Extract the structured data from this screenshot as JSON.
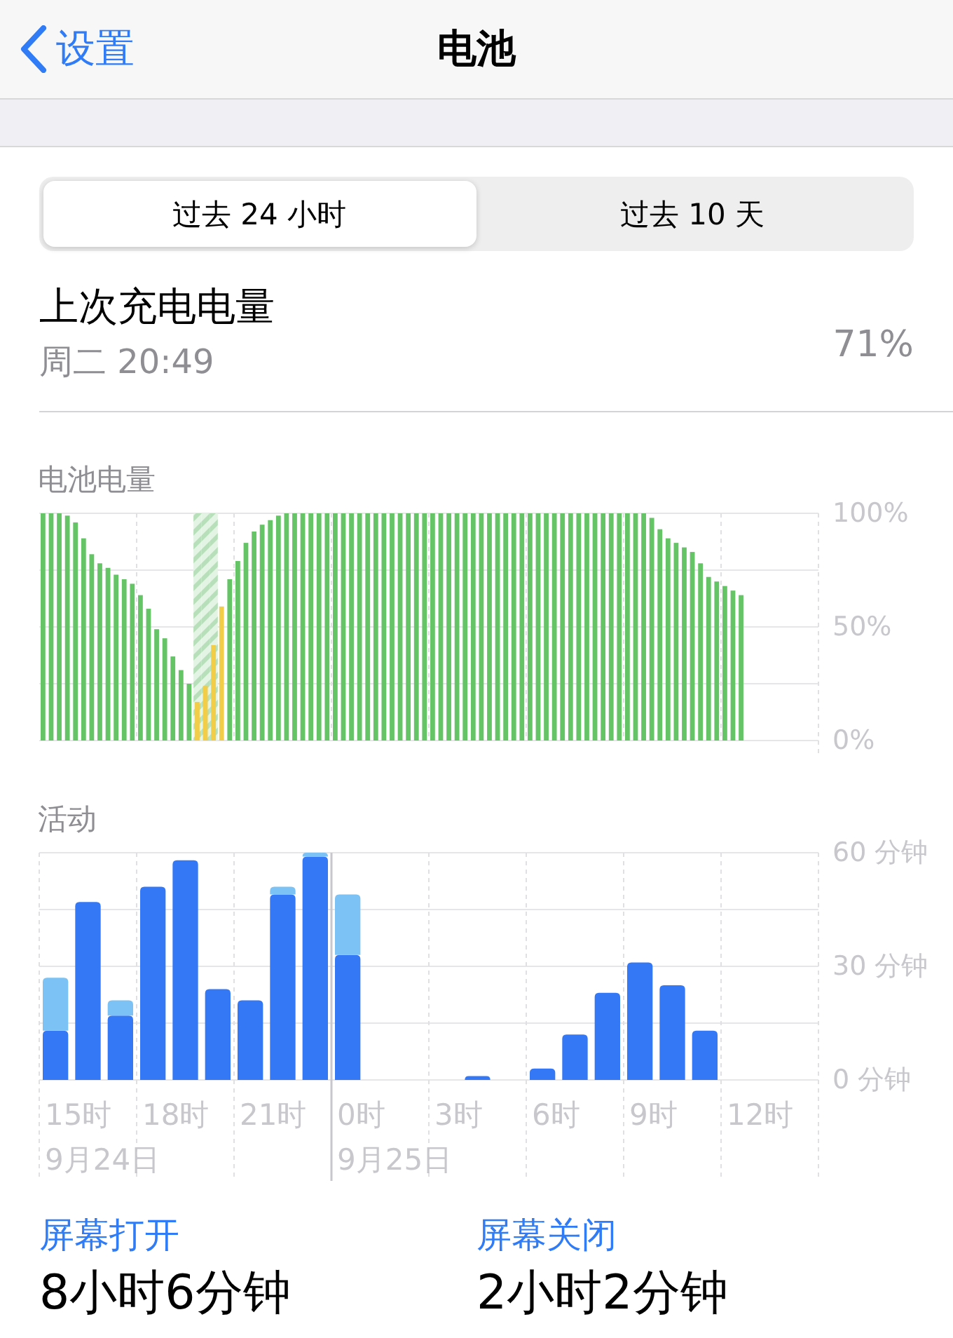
{
  "nav": {
    "back_label": "设置",
    "title": "电池"
  },
  "segments": [
    {
      "label": "过去 24 小时",
      "selected": true
    },
    {
      "label": "过去 10 天",
      "selected": false
    }
  ],
  "last_charge": {
    "label": "上次充电电量",
    "time": "周二 20:49",
    "level_text": "71%"
  },
  "battery": {
    "heading": "电池电量",
    "chart_data": {
      "type": "bar",
      "grid": true,
      "ylim": [
        0,
        100
      ],
      "yticks": [
        {
          "value": 0,
          "label": "0%"
        },
        {
          "value": 50,
          "label": "50%"
        },
        {
          "value": 100,
          "label": "100%"
        }
      ],
      "series": [
        {
          "color": "#b7dfb9",
          "values": [
            null,
            null,
            null,
            null,
            null,
            null,
            null,
            null,
            null,
            null,
            null,
            null,
            null,
            null,
            null,
            null,
            null,
            null,
            null,
            100,
            100,
            100,
            null,
            null,
            null,
            null,
            null,
            null,
            null,
            null,
            null,
            null,
            null,
            null,
            null,
            null,
            null,
            null,
            null,
            null,
            null,
            null,
            null,
            null,
            null,
            null,
            null,
            null,
            null,
            null,
            null,
            null,
            null,
            null,
            null,
            null,
            null,
            null,
            null,
            null,
            null,
            null,
            null,
            null,
            null,
            null,
            null,
            null,
            null,
            null,
            null,
            null,
            null,
            null,
            null,
            null,
            null,
            null,
            null,
            null,
            null,
            null,
            null,
            null,
            null,
            null,
            null,
            null,
            null,
            null,
            null,
            null,
            null,
            null,
            null,
            null
          ]
        },
        {
          "color": "#65c466",
          "values": [
            100,
            100,
            100,
            99,
            96,
            89,
            82,
            78,
            76,
            73,
            71,
            69,
            64,
            58,
            49,
            45,
            37,
            31,
            25,
            null,
            null,
            null,
            null,
            71,
            79,
            87,
            92,
            95,
            97,
            99,
            100,
            100,
            100,
            100,
            100,
            100,
            100,
            100,
            100,
            100,
            100,
            100,
            100,
            100,
            100,
            100,
            100,
            100,
            100,
            100,
            100,
            100,
            100,
            100,
            100,
            100,
            100,
            100,
            100,
            100,
            100,
            100,
            100,
            100,
            100,
            100,
            100,
            100,
            100,
            100,
            100,
            100,
            100,
            100,
            100,
            98,
            93,
            89,
            87,
            85,
            83,
            78,
            72,
            70,
            68,
            66,
            64,
            null,
            null,
            null,
            null,
            null,
            null,
            null,
            null,
            null
          ]
        },
        {
          "color": "#f2cd48",
          "values": [
            null,
            null,
            null,
            null,
            null,
            null,
            null,
            null,
            null,
            null,
            null,
            null,
            null,
            null,
            null,
            null,
            null,
            null,
            null,
            17,
            24,
            42,
            59,
            null,
            null,
            null,
            null,
            null,
            null,
            null,
            null,
            null,
            null,
            null,
            null,
            null,
            null,
            null,
            null,
            null,
            null,
            null,
            null,
            null,
            null,
            null,
            null,
            null,
            null,
            null,
            null,
            null,
            null,
            null,
            null,
            null,
            null,
            null,
            null,
            null,
            null,
            null,
            null,
            null,
            null,
            null,
            null,
            null,
            null,
            null,
            null,
            null,
            null,
            null,
            null,
            null,
            null,
            null,
            null,
            null,
            null,
            null,
            null,
            null,
            null,
            null,
            null,
            null,
            null,
            null,
            null,
            null,
            null,
            null,
            null,
            null
          ]
        }
      ]
    }
  },
  "activity": {
    "heading": "活动",
    "chart_data": {
      "type": "bar",
      "stacked": true,
      "grid": true,
      "ylim": [
        0,
        60
      ],
      "yticks": [
        {
          "value": 0,
          "label": "0 分钟"
        },
        {
          "value": 30,
          "label": "30 分钟"
        },
        {
          "value": 60,
          "label": "60 分钟"
        }
      ],
      "series": [
        {
          "color": "#3478f6",
          "values": [
            13,
            47,
            17,
            51,
            58,
            24,
            21,
            49,
            59,
            33,
            0,
            0,
            0,
            1,
            0,
            3,
            12,
            23,
            31,
            25,
            13,
            0,
            0,
            0
          ]
        },
        {
          "color": "#7cc2f4",
          "values": [
            14,
            0,
            4,
            0,
            0,
            0,
            0,
            2,
            1,
            16,
            0,
            0,
            0,
            0,
            0,
            0,
            0,
            0,
            0,
            0,
            0,
            0,
            0,
            0
          ]
        }
      ]
    },
    "days": [
      {
        "hours": [
          "15时",
          "18时",
          "21时"
        ],
        "date": "9月24日"
      },
      {
        "hours": [
          "0时",
          "3时",
          "6时",
          "9时",
          "12时"
        ],
        "date": "9月25日"
      }
    ]
  },
  "totals": [
    {
      "label": "屏幕打开",
      "value": "8小时6分钟"
    },
    {
      "label": "屏幕关闭",
      "value": "2小时2分钟"
    }
  ]
}
